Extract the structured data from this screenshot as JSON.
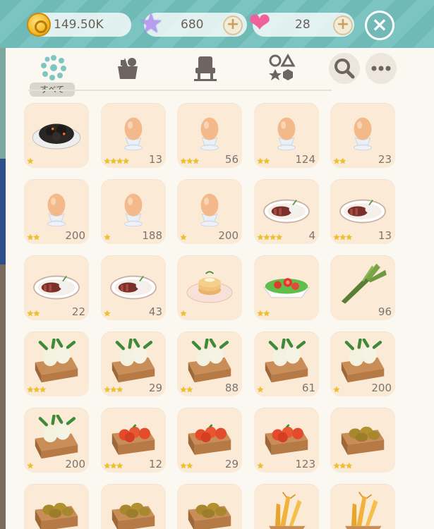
{
  "header": {
    "coins": "149.50K",
    "stars": "680",
    "hearts": "28",
    "plus_label": "+",
    "close_label": "×"
  },
  "tabs": [
    {
      "icon": "all-items-icon",
      "label": "すべて",
      "selected": true
    },
    {
      "icon": "ingredients-icon"
    },
    {
      "icon": "furniture-icon"
    },
    {
      "icon": "shapes-icon"
    }
  ],
  "search_icon": "search-icon",
  "more_icon": "more-icon",
  "items": [
    {
      "kind": "charred",
      "stars": 1,
      "count": ""
    },
    {
      "kind": "egg",
      "stars": 4,
      "count": "13"
    },
    {
      "kind": "egg",
      "stars": 3,
      "count": "56"
    },
    {
      "kind": "egg",
      "stars": 2,
      "count": "124"
    },
    {
      "kind": "egg",
      "stars": 2,
      "count": "23"
    },
    {
      "kind": "egg",
      "stars": 2,
      "count": "200"
    },
    {
      "kind": "egg",
      "stars": 1,
      "count": "188"
    },
    {
      "kind": "egg",
      "stars": 1,
      "count": "200"
    },
    {
      "kind": "steak",
      "stars": 4,
      "count": "4"
    },
    {
      "kind": "steak",
      "stars": 3,
      "count": "13"
    },
    {
      "kind": "steak",
      "stars": 2,
      "count": "22"
    },
    {
      "kind": "steak",
      "stars": 1,
      "count": "43"
    },
    {
      "kind": "pancake",
      "stars": 1,
      "count": ""
    },
    {
      "kind": "salad",
      "stars": 2,
      "count": ""
    },
    {
      "kind": "leek",
      "stars": 0,
      "count": "96"
    },
    {
      "kind": "turnip",
      "stars": 3,
      "count": ""
    },
    {
      "kind": "turnip",
      "stars": 3,
      "count": "29"
    },
    {
      "kind": "turnip",
      "stars": 2,
      "count": "88"
    },
    {
      "kind": "turnip",
      "stars": 1,
      "count": "61"
    },
    {
      "kind": "turnip",
      "stars": 1,
      "count": "200"
    },
    {
      "kind": "turnip",
      "stars": 1,
      "count": "200"
    },
    {
      "kind": "tomato",
      "stars": 3,
      "count": "12"
    },
    {
      "kind": "tomato",
      "stars": 2,
      "count": "29"
    },
    {
      "kind": "tomato",
      "stars": 1,
      "count": "123"
    },
    {
      "kind": "potato",
      "stars": 3,
      "count": ""
    },
    {
      "kind": "potato",
      "stars": 0,
      "count": ""
    },
    {
      "kind": "potato",
      "stars": 0,
      "count": ""
    },
    {
      "kind": "potato",
      "stars": 0,
      "count": ""
    },
    {
      "kind": "wheat",
      "stars": 0,
      "count": ""
    },
    {
      "kind": "wheat",
      "stars": 0,
      "count": ""
    }
  ]
}
